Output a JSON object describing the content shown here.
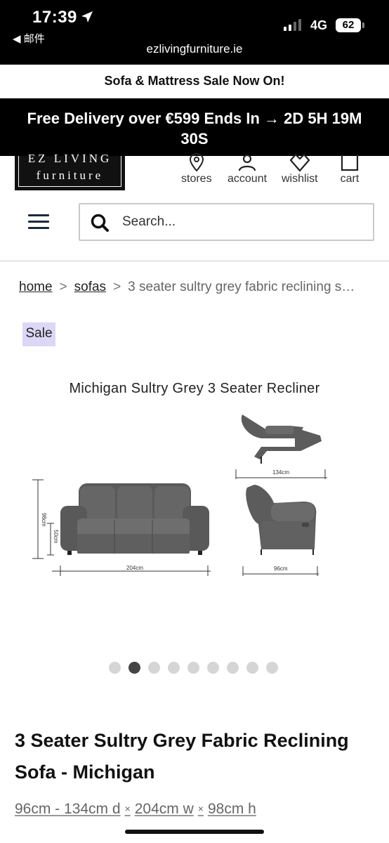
{
  "status_bar": {
    "time": "17:39",
    "back_app": "◀ 邮件",
    "network": "4G",
    "battery": "62"
  },
  "browser": {
    "url": "ezlivingfurniture.ie"
  },
  "promo": {
    "sale_banner": "Sofa & Mattress Sale Now On!",
    "delivery_banner": "Free Delivery over €599 Ends In → 2D 5H 19M 30S"
  },
  "header": {
    "logo_top": "EZ LIVING",
    "logo_bottom": "furniture",
    "nav": [
      {
        "label": "stores",
        "icon": "location-pin-icon"
      },
      {
        "label": "account",
        "icon": "user-icon"
      },
      {
        "label": "wishlist",
        "icon": "heart-icon"
      },
      {
        "label": "cart",
        "icon": "cart-icon"
      }
    ]
  },
  "search": {
    "placeholder": "Search..."
  },
  "breadcrumb": {
    "home": "home",
    "sofas": "sofas",
    "separator": ">",
    "current": "3 seater sultry grey fabric reclining s…"
  },
  "badge": {
    "sale": "Sale"
  },
  "product_image": {
    "caption": "Michigan Sultry Grey 3 Seater Recliner",
    "dim_depth_reclined": "134cm",
    "dim_width": "204cm",
    "dim_depth": "96cm",
    "dim_height": "98cm",
    "dim_seat_height": "50cm"
  },
  "carousel": {
    "count": 9,
    "active_index": 1
  },
  "product": {
    "title": "3 Seater Sultry Grey Fabric Reclining Sofa - Michigan",
    "dims_d": "96cm - 134cm d",
    "dims_w": "204cm w",
    "dims_h": "98cm h",
    "dims_sep": "×"
  }
}
